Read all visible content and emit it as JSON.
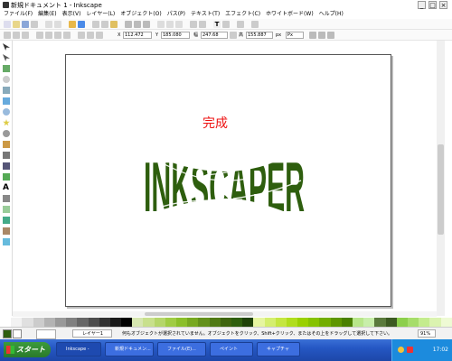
{
  "window": {
    "title": "新規ドキュメント 1 - Inkscape",
    "buttons": [
      "_",
      "□",
      "×"
    ]
  },
  "menubar": {
    "items": [
      "ファイル(F)",
      "編集(E)",
      "表示(V)",
      "レイヤー(L)",
      "オブジェクト(O)",
      "パス(P)",
      "テキスト(T)",
      "エフェクト(C)",
      "ホワイトボード(W)",
      "ヘルプ(H)"
    ]
  },
  "toolbar2": {
    "x_label": "X",
    "x_value": "112.472",
    "y_label": "Y",
    "y_value": "185.080",
    "w_label": "幅",
    "w_value": "247.68",
    "h_label": "高",
    "h_value": "155.887",
    "unit": "px",
    "select": "Px"
  },
  "canvas": {
    "heading": "完成",
    "logo_text": "INKSCAPER",
    "heading_color": "#ee1111",
    "logo_color": "#2e5e0e"
  },
  "palette": {
    "colors": [
      "#ffffff",
      "#f2f2f2",
      "#e0e0e0",
      "#cccccc",
      "#b3b3b3",
      "#999999",
      "#808080",
      "#666666",
      "#4d4d4d",
      "#333333",
      "#1a1a1a",
      "#000000",
      "#d6e6b0",
      "#c8e08c",
      "#b5d66a",
      "#a0cc44",
      "#8bbf2a",
      "#77a820",
      "#63901a",
      "#507a14",
      "#3e640e",
      "#2e5e0e",
      "#1f4208",
      "#e6f5a0",
      "#d4ee6e",
      "#c4e640",
      "#b0dd1c",
      "#9ad000",
      "#86c200",
      "#72ad00",
      "#5e9600",
      "#4a8000",
      "#b8e68a",
      "#c8eeaa",
      "#5a7a3c",
      "#3c5a22",
      "#8ccf4c",
      "#a6dd6a",
      "#c4ec8e",
      "#dbf3b0",
      "#eefad4"
    ]
  },
  "statusbar": {
    "layer": "レイヤー1",
    "message": "何もオブジェクトが選択されていません。オブジェクトをクリック、Shift+クリック、またはその上をドラッグして選択して下さい。",
    "zoom": "91%"
  },
  "taskbar": {
    "start_label": "スタート",
    "tasks": [
      "Inkscape -",
      "新規ドキュメン...",
      "ファイル(E)...",
      "ペイント",
      "キャプチャ"
    ],
    "clock": "17:02"
  }
}
